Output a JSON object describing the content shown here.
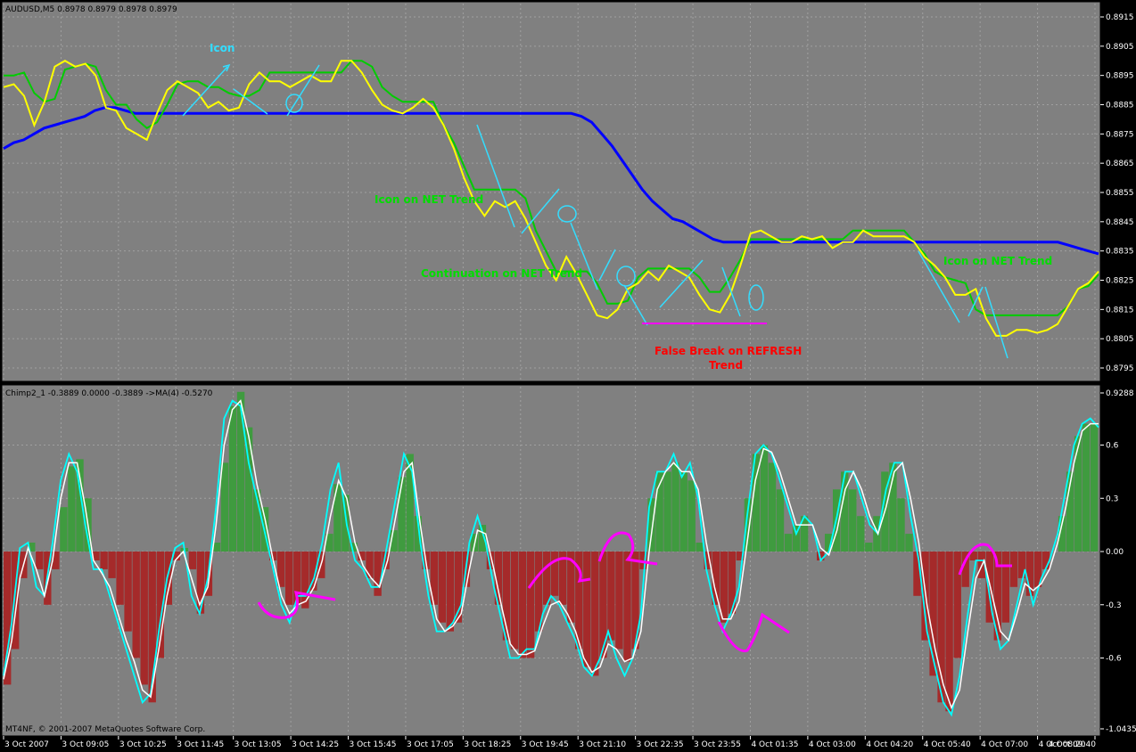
{
  "colors": {
    "background": "#808080",
    "frame": "#000000",
    "grid": "#a0a0a0",
    "price_ma_fast": "#ffff00",
    "price_ma_slow": "#00cc00",
    "price_ma_long": "#0000ff",
    "osc_line": "#00ffff",
    "osc_signal": "#ffffff",
    "hist_positive": "#3f9b3f",
    "hist_negative": "#a52a2a",
    "annot_cyan": "#33ddff",
    "annot_green": "#00dd00",
    "annot_magenta": "#ff00ff",
    "annot_red": "#ff0000"
  },
  "header": {
    "price_title": "AUDUSD,M5  0.8978 0.8979 0.8978 0.8979",
    "osc_title": "Chimp2_1 -0.3889 0.0000 -0.3889  ->MA(4) -0.5270",
    "copyright": "MT4NF, © 2001-2007 MetaQuotes Software Corp."
  },
  "annotations": {
    "icon": "Icon",
    "icon_on_net": "Icon on NET Trend",
    "continuation": "Continuation on NET Trend",
    "false_break_1": "False Break on REFRESH",
    "false_break_2": "Trend",
    "icon_on_net_2": "Icon on NET Trend"
  },
  "chart_data": [
    {
      "type": "line",
      "panel": "price",
      "symbol": "AUDUSD",
      "timeframe": "M5",
      "ylim": [
        0.879,
        0.892
      ],
      "y_ticks": [
        "0.8915",
        "0.8905",
        "0.8895",
        "0.8885",
        "0.8875",
        "0.8865",
        "0.8855",
        "0.8845",
        "0.8835",
        "0.8825",
        "0.8815",
        "0.8805",
        "0.8795"
      ],
      "x_ticks": [
        "3 Oct 2007",
        "3 Oct 09:05",
        "3 Oct 10:25",
        "3 Oct 11:45",
        "3 Oct 13:05",
        "3 Oct 14:25",
        "3 Oct 15:45",
        "3 Oct 17:05",
        "3 Oct 18:25",
        "3 Oct 19:45",
        "3 Oct 21:10",
        "3 Oct 22:35",
        "3 Oct 23:55",
        "4 Oct 01:35",
        "4 Oct 03:00",
        "4 Oct 04:20",
        "4 Oct 05:40",
        "4 Oct 07:00",
        "4 Oct 08:20",
        "4 Oct 09:40"
      ],
      "grid": true,
      "series": [
        {
          "key": "fast",
          "values": [
            0.8891,
            0.8892,
            0.8888,
            0.8878,
            0.8886,
            0.8898,
            0.89,
            0.8898,
            0.8899,
            0.8895,
            0.8884,
            0.8883,
            0.8877,
            0.8875,
            0.8873,
            0.8882,
            0.889,
            0.8893,
            0.8891,
            0.8889,
            0.8884,
            0.8886,
            0.8883,
            0.8884,
            0.8892,
            0.8896,
            0.8893,
            0.8893,
            0.8891,
            0.8893,
            0.8895,
            0.8893,
            0.8893,
            0.89,
            0.89,
            0.8896,
            0.889,
            0.8885,
            0.8883,
            0.8882,
            0.8884,
            0.8887,
            0.8884,
            0.8878,
            0.887,
            0.886,
            0.8852,
            0.8847,
            0.8852,
            0.885,
            0.8852,
            0.8846,
            0.8838,
            0.883,
            0.8825,
            0.8833,
            0.8827,
            0.882,
            0.8813,
            0.8812,
            0.8815,
            0.8822,
            0.8824,
            0.8828,
            0.8825,
            0.883,
            0.8828,
            0.8826,
            0.882,
            0.8815,
            0.8814,
            0.882,
            0.883,
            0.8841,
            0.8842,
            0.884,
            0.8838,
            0.8838,
            0.884,
            0.8839,
            0.884,
            0.8836,
            0.8838,
            0.8838,
            0.8842,
            0.884,
            0.884,
            0.884,
            0.884,
            0.8838,
            0.8833,
            0.883,
            0.8826,
            0.882,
            0.882,
            0.8822,
            0.8812,
            0.8806,
            0.8806,
            0.8808,
            0.8808,
            0.8807,
            0.8808,
            0.881,
            0.8816,
            0.8822,
            0.8824,
            0.8828
          ]
        },
        {
          "key": "slow",
          "values": [
            0.8895,
            0.8895,
            0.8896,
            0.8889,
            0.8886,
            0.8887,
            0.8897,
            0.8898,
            0.8899,
            0.8898,
            0.889,
            0.8885,
            0.8885,
            0.888,
            0.8877,
            0.8879,
            0.8885,
            0.8892,
            0.8893,
            0.8893,
            0.8891,
            0.8891,
            0.8889,
            0.8888,
            0.8888,
            0.889,
            0.8896,
            0.8896,
            0.8896,
            0.8896,
            0.8896,
            0.8896,
            0.8896,
            0.8896,
            0.89,
            0.89,
            0.8898,
            0.8891,
            0.8888,
            0.8886,
            0.8886,
            0.8886,
            0.8886,
            0.8878,
            0.8872,
            0.8864,
            0.8856,
            0.8856,
            0.8856,
            0.8856,
            0.8856,
            0.8853,
            0.8842,
            0.8835,
            0.8828,
            0.8828,
            0.8828,
            0.8828,
            0.8824,
            0.8817,
            0.8817,
            0.8818,
            0.8826,
            0.8829,
            0.8829,
            0.8829,
            0.8829,
            0.8829,
            0.8826,
            0.8821,
            0.8821,
            0.8826,
            0.8832,
            0.8839,
            0.8839,
            0.8839,
            0.8839,
            0.8839,
            0.8839,
            0.8839,
            0.8839,
            0.8839,
            0.8839,
            0.8842,
            0.8842,
            0.8842,
            0.8842,
            0.8842,
            0.8842,
            0.8838,
            0.8834,
            0.8828,
            0.8826,
            0.8825,
            0.8824,
            0.8815,
            0.8813,
            0.8813,
            0.8813,
            0.8813,
            0.8813,
            0.8813,
            0.8813,
            0.8813,
            0.8816,
            0.8822,
            0.8823,
            0.8827
          ]
        },
        {
          "key": "long",
          "values": [
            0.887,
            0.8872,
            0.8873,
            0.8875,
            0.8877,
            0.8878,
            0.8879,
            0.888,
            0.8881,
            0.8883,
            0.8884,
            0.8884,
            0.8883,
            0.8882,
            0.8882,
            0.8882,
            0.8882,
            0.8882,
            0.8882,
            0.8882,
            0.8882,
            0.8882,
            0.8882,
            0.8882,
            0.8882,
            0.8882,
            0.8882,
            0.8882,
            0.8882,
            0.8882,
            0.8882,
            0.8882,
            0.8882,
            0.8882,
            0.8882,
            0.8882,
            0.8882,
            0.8882,
            0.8882,
            0.8882,
            0.8882,
            0.8882,
            0.8882,
            0.8882,
            0.8882,
            0.8882,
            0.8882,
            0.8882,
            0.8882,
            0.8882,
            0.8882,
            0.8882,
            0.8882,
            0.8882,
            0.8882,
            0.8882,
            0.8882,
            0.8881,
            0.8879,
            0.8875,
            0.8871,
            0.8866,
            0.8861,
            0.8856,
            0.8852,
            0.8849,
            0.8846,
            0.8845,
            0.8843,
            0.8841,
            0.8839,
            0.8838,
            0.8838,
            0.8838,
            0.8838,
            0.8838,
            0.8838,
            0.8838,
            0.8838,
            0.8838,
            0.8838,
            0.8838,
            0.8838,
            0.8838,
            0.8838,
            0.8838,
            0.8838,
            0.8838,
            0.8838,
            0.8838,
            0.8838,
            0.8838,
            0.8838,
            0.8838,
            0.8838,
            0.8838,
            0.8838,
            0.8838,
            0.8838,
            0.8838,
            0.8838,
            0.8838,
            0.8838,
            0.8838,
            0.8838,
            0.8837,
            0.8836,
            0.8835,
            0.8834
          ]
        }
      ]
    },
    {
      "type": "bar",
      "panel": "oscillator",
      "ylim": [
        -1.0435,
        0.9288
      ],
      "y_ticks": [
        "0.9288",
        "0.6",
        "0.3",
        "0.00",
        "-0.3",
        "-0.6",
        "-1.0435"
      ],
      "grid": true,
      "series": [
        {
          "key": "histogram",
          "values": [
            -0.75,
            -0.55,
            -0.15,
            0.05,
            -0.1,
            -0.3,
            -0.1,
            0.25,
            0.48,
            0.52,
            0.3,
            -0.05,
            -0.1,
            -0.15,
            -0.3,
            -0.45,
            -0.6,
            -0.75,
            -0.85,
            -0.6,
            -0.3,
            -0.05,
            0.02,
            -0.1,
            -0.35,
            -0.25,
            0.05,
            0.5,
            0.82,
            0.9,
            0.7,
            0.35,
            0.25,
            -0.05,
            -0.2,
            -0.3,
            -0.3,
            -0.32,
            -0.22,
            -0.15,
            0.1,
            0.38,
            0.32,
            0.05,
            -0.05,
            -0.15,
            -0.25,
            -0.1,
            0.12,
            0.42,
            0.55,
            0.2,
            -0.1,
            -0.3,
            -0.4,
            -0.45,
            -0.4,
            -0.2,
            0.1,
            0.15,
            -0.1,
            -0.3,
            -0.5,
            -0.55,
            -0.6,
            -0.6,
            -0.45,
            -0.3,
            -0.25,
            -0.3,
            -0.4,
            -0.55,
            -0.65,
            -0.7,
            -0.6,
            -0.5,
            -0.55,
            -0.62,
            -0.55,
            -0.1,
            0.3,
            0.45,
            0.45,
            0.5,
            0.45,
            0.4,
            0.05,
            -0.1,
            -0.3,
            -0.4,
            -0.35,
            -0.05,
            0.3,
            0.55,
            0.6,
            0.5,
            0.35,
            0.1,
            0.15,
            0.2,
            0.0,
            -0.05,
            0.1,
            0.35,
            0.45,
            0.35,
            0.2,
            0.05,
            0.2,
            0.45,
            0.5,
            0.3,
            0.1,
            -0.25,
            -0.5,
            -0.7,
            -0.85,
            -0.9,
            -0.6,
            -0.2,
            -0.05,
            -0.15,
            -0.4,
            -0.5,
            -0.4,
            -0.2,
            -0.15,
            -0.25,
            -0.2,
            -0.1,
            0.0,
            0.2,
            0.45,
            0.65,
            0.72,
            0.72
          ]
        },
        {
          "key": "line",
          "values": [
            -0.7,
            -0.4,
            0.02,
            0.05,
            -0.2,
            -0.25,
            0.05,
            0.4,
            0.55,
            0.45,
            0.15,
            -0.1,
            -0.1,
            -0.25,
            -0.4,
            -0.55,
            -0.7,
            -0.85,
            -0.8,
            -0.45,
            -0.15,
            0.02,
            0.05,
            -0.25,
            -0.35,
            -0.15,
            0.25,
            0.75,
            0.85,
            0.82,
            0.5,
            0.3,
            0.1,
            -0.1,
            -0.3,
            -0.4,
            -0.25,
            -0.25,
            -0.15,
            0.05,
            0.35,
            0.5,
            0.15,
            -0.05,
            -0.1,
            -0.2,
            -0.2,
            0.05,
            0.3,
            0.55,
            0.45,
            0.05,
            -0.25,
            -0.45,
            -0.45,
            -0.4,
            -0.3,
            0.05,
            0.2,
            0.05,
            -0.2,
            -0.4,
            -0.6,
            -0.6,
            -0.55,
            -0.55,
            -0.35,
            -0.25,
            -0.3,
            -0.4,
            -0.5,
            -0.65,
            -0.7,
            -0.6,
            -0.45,
            -0.6,
            -0.7,
            -0.6,
            -0.35,
            0.25,
            0.45,
            0.45,
            0.55,
            0.42,
            0.5,
            0.3,
            -0.1,
            -0.3,
            -0.45,
            -0.35,
            -0.2,
            0.2,
            0.55,
            0.6,
            0.55,
            0.4,
            0.25,
            0.1,
            0.2,
            0.15,
            -0.05,
            0.0,
            0.2,
            0.45,
            0.45,
            0.3,
            0.15,
            0.1,
            0.35,
            0.5,
            0.5,
            0.2,
            -0.05,
            -0.45,
            -0.65,
            -0.85,
            -0.92,
            -0.7,
            -0.35,
            -0.05,
            -0.05,
            -0.35,
            -0.55,
            -0.5,
            -0.3,
            -0.1,
            -0.3,
            -0.15,
            -0.05,
            0.1,
            0.35,
            0.6,
            0.72,
            0.75,
            0.7
          ]
        },
        {
          "key": "signal",
          "values": [
            -0.72,
            -0.5,
            -0.15,
            0.02,
            -0.1,
            -0.25,
            -0.05,
            0.3,
            0.5,
            0.5,
            0.25,
            -0.05,
            -0.12,
            -0.2,
            -0.35,
            -0.5,
            -0.62,
            -0.78,
            -0.82,
            -0.55,
            -0.25,
            -0.05,
            0.0,
            -0.15,
            -0.3,
            -0.2,
            0.15,
            0.6,
            0.8,
            0.85,
            0.65,
            0.38,
            0.18,
            -0.05,
            -0.25,
            -0.35,
            -0.3,
            -0.28,
            -0.2,
            -0.05,
            0.2,
            0.4,
            0.3,
            0.05,
            -0.08,
            -0.15,
            -0.2,
            -0.05,
            0.2,
            0.45,
            0.5,
            0.15,
            -0.15,
            -0.38,
            -0.45,
            -0.42,
            -0.35,
            -0.1,
            0.12,
            0.1,
            -0.1,
            -0.32,
            -0.52,
            -0.58,
            -0.58,
            -0.56,
            -0.42,
            -0.3,
            -0.28,
            -0.35,
            -0.45,
            -0.6,
            -0.68,
            -0.65,
            -0.52,
            -0.55,
            -0.62,
            -0.6,
            -0.45,
            0.0,
            0.35,
            0.45,
            0.5,
            0.45,
            0.45,
            0.35,
            0.05,
            -0.2,
            -0.38,
            -0.38,
            -0.28,
            0.05,
            0.4,
            0.58,
            0.56,
            0.45,
            0.3,
            0.15,
            0.15,
            0.15,
            0.02,
            -0.02,
            0.12,
            0.35,
            0.45,
            0.35,
            0.2,
            0.1,
            0.25,
            0.45,
            0.5,
            0.3,
            0.05,
            -0.3,
            -0.55,
            -0.75,
            -0.88,
            -0.78,
            -0.45,
            -0.15,
            -0.05,
            -0.25,
            -0.45,
            -0.5,
            -0.35,
            -0.18,
            -0.22,
            -0.18,
            -0.1,
            0.05,
            0.25,
            0.5,
            0.68,
            0.72,
            0.72
          ]
        }
      ]
    }
  ]
}
